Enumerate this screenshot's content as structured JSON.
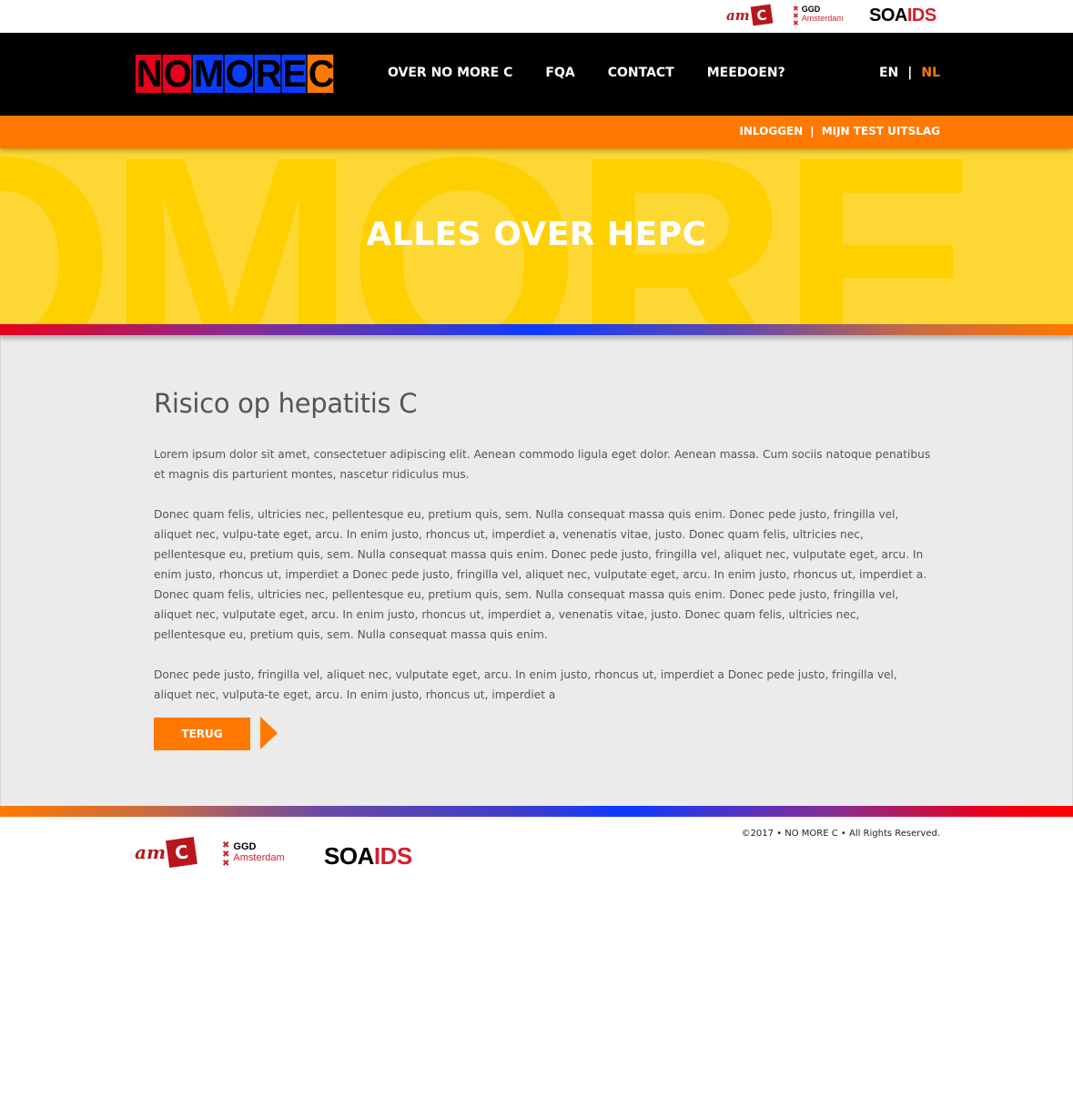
{
  "partners": {
    "amc": {
      "prefix": "am",
      "mark": "C"
    },
    "ggd": {
      "line1": "GGD",
      "line2": "Amsterdam",
      "crosses": [
        "✖",
        "✖",
        "✖"
      ]
    },
    "soaids": {
      "part1": "SOA",
      "part2": "IDS"
    }
  },
  "header": {
    "brand_letters": [
      "N",
      "O",
      "M",
      "O",
      "R",
      "E",
      "C"
    ],
    "nav": [
      "OVER NO MORE C",
      "FQA",
      "CONTACT",
      "MEEDOEN?"
    ],
    "lang": {
      "en": "EN",
      "separator": "|",
      "nl": "NL",
      "active": "NL"
    }
  },
  "userbar": {
    "login": "INLOGGEN",
    "separator": "|",
    "results": "MIJN TEST UITSLAG"
  },
  "hero": {
    "title": "ALLES OVER HEPC",
    "background_text": "OMORE"
  },
  "article": {
    "title": "Risico op hepatitis C",
    "paragraphs": [
      "Lorem ipsum dolor sit amet, consectetuer adipiscing elit. Aenean commodo ligula eget dolor. Aenean massa. Cum sociis natoque penatibus et magnis dis parturient montes, nascetur ridiculus mus.",
      "Donec quam felis, ultricies nec, pellentesque eu, pretium quis, sem. Nulla consequat massa quis enim. Donec pede justo, fringilla vel, aliquet nec, vulpu-tate eget, arcu. In enim justo, rhoncus ut, imperdiet a, venenatis vitae, justo. Donec quam felis, ultricies nec, pellentesque eu, pretium quis, sem. Nulla consequat massa quis enim. Donec pede justo, fringilla vel, aliquet nec, vulputate eget, arcu. In enim justo, rhoncus ut, imperdiet a Donec pede justo, fringilla vel, aliquet nec, vulputate eget, arcu. In enim justo, rhoncus ut, imperdiet a. Donec quam felis, ultricies nec, pellentesque eu, pretium quis, sem. Nulla consequat massa quis enim. Donec pede justo, fringilla vel, aliquet nec, vulputate eget, arcu. In enim justo, rhoncus ut, imperdiet a, venenatis vitae, justo. Donec quam felis, ultricies nec, pellentesque eu, pretium quis, sem. Nulla consequat massa quis enim.",
      "Donec pede justo, fringilla vel, aliquet nec, vulputate eget, arcu. In enim justo, rhoncus ut, imperdiet a Donec pede justo, fringilla vel, aliquet nec, vulputa-te eget, arcu. In enim justo, rhoncus ut, imperdiet a"
    ],
    "back_label": "TERUG"
  },
  "footer": {
    "copyright": "©2017 • NO MORE C  • All Rights Reserved."
  },
  "colors": {
    "accent_orange": "#ff7800",
    "brand_red": "#e8001c",
    "brand_blue": "#0b3bff",
    "hero_yellow": "#fdd835",
    "partner_red": "#d0202e"
  }
}
